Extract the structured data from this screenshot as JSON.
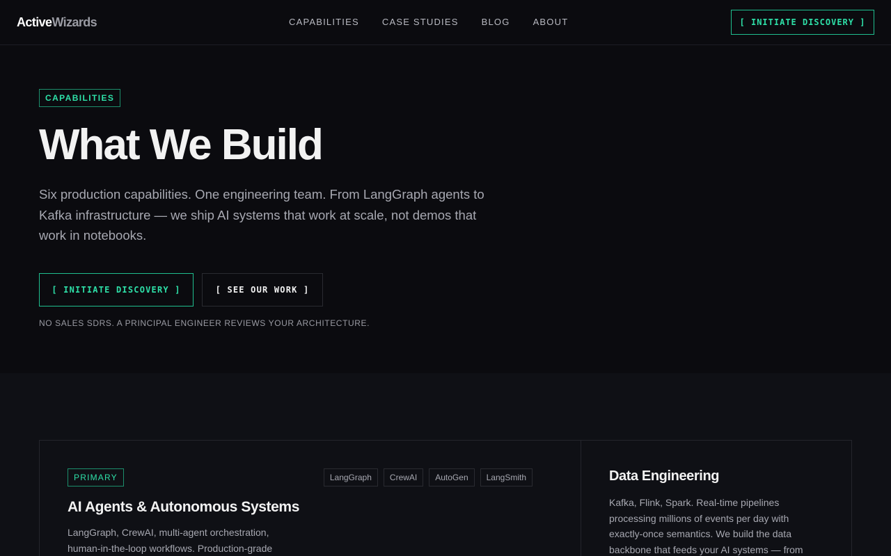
{
  "header": {
    "logo_primary": "Active",
    "logo_secondary": "Wizards",
    "nav": [
      "CAPABILITIES",
      "CASE STUDIES",
      "BLOG",
      "ABOUT"
    ],
    "cta": "[ INITIATE DISCOVERY ]"
  },
  "hero": {
    "eyebrow": "CAPABILITIES",
    "title": "What We Build",
    "description": "Six production capabilities. One engineering team. From LangGraph agents to Kafka infrastructure — we ship AI systems that work at scale, not demos that work in notebooks.",
    "primary_button": "[ INITIATE DISCOVERY ]",
    "secondary_button": "[ SEE OUR WORK ]",
    "note": "NO SALES SDRS. A PRINCIPAL ENGINEER REVIEWS YOUR ARCHITECTURE."
  },
  "cards": {
    "main": {
      "badge": "PRIMARY",
      "tags": [
        "LangGraph",
        "CrewAI",
        "AutoGen",
        "LangSmith"
      ],
      "title": "AI Agents & Autonomous Systems",
      "description": "LangGraph, CrewAI, multi-agent orchestration, human-in-the-loop workflows. Production-grade"
    },
    "side": {
      "title": "Data Engineering",
      "description": "Kafka, Flink, Spark. Real-time pipelines processing millions of events per day with exactly-once semantics. We build the data backbone that feeds your AI systems — from"
    }
  },
  "colors": {
    "background": "#0b0b0f",
    "section_background": "#0f1015",
    "accent": "#2ee0a8",
    "accent_border": "#1fbf8f",
    "text_primary": "#f2f2f2",
    "text_muted": "#a7a8b1"
  }
}
